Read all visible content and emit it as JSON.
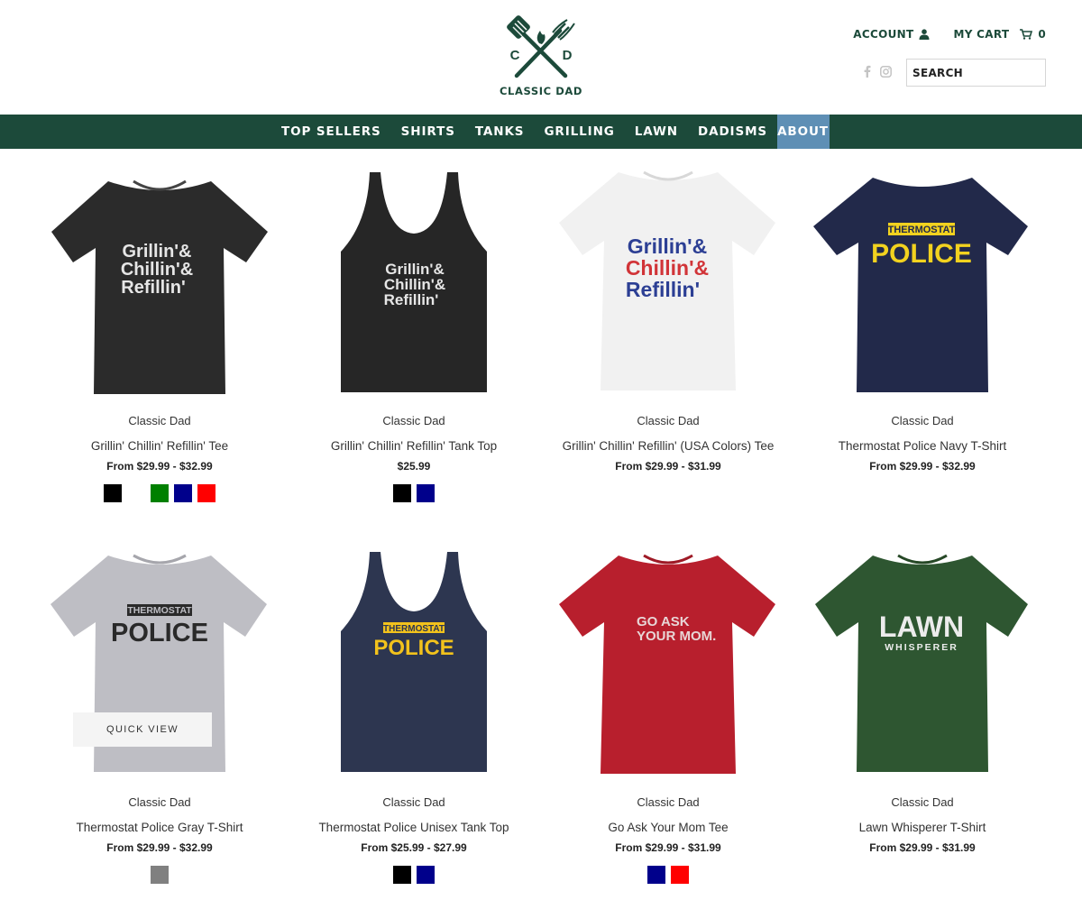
{
  "brand": {
    "logo_letter_left": "C",
    "logo_letter_right": "D",
    "name": "CLASSIC DAD",
    "color": "#1c4a3a"
  },
  "top_links": {
    "account": "ACCOUNT",
    "cart": "MY CART",
    "cart_count": "0"
  },
  "search": {
    "placeholder": "SEARCH"
  },
  "nav": {
    "items": [
      "TOP SELLERS",
      "SHIRTS",
      "TANKS",
      "GRILLING",
      "LAWN",
      "DADISMS",
      "ABOUT"
    ],
    "active": "ABOUT",
    "active_color": "#5e8fb5"
  },
  "products": [
    {
      "vendor": "Classic Dad",
      "title": "Grillin' Chillin' Refillin' Tee",
      "price": "From $29.99 - $32.99",
      "garment": "tee",
      "garment_color": "#2b2b2b",
      "print": [
        "Grillin'&",
        "Chillin'&",
        "Refillin'"
      ],
      "print_colors": [
        "#e6e6e6",
        "#e6e6e6",
        "#e6e6e6"
      ],
      "swatches": [
        "#000000",
        "#ffffff",
        "#008000",
        "#00008b",
        "#ff0000"
      ]
    },
    {
      "vendor": "Classic Dad",
      "title": "Grillin' Chillin' Refillin' Tank Top",
      "price": "$25.99",
      "garment": "tank",
      "garment_color": "#262626",
      "print": [
        "Grillin'&",
        "Chillin'&",
        "Refillin'"
      ],
      "print_colors": [
        "#e6e6e6",
        "#e6e6e6",
        "#e6e6e6"
      ],
      "swatches": [
        "#000000",
        "#00008b"
      ]
    },
    {
      "vendor": "Classic Dad",
      "title": "Grillin' Chillin' Refillin' (USA Colors) Tee",
      "price": "From $29.99 - $31.99",
      "garment": "tee",
      "garment_color": "#f1f1f1",
      "print": [
        "Grillin'&",
        "Chillin'&",
        "Refillin'"
      ],
      "print_colors": [
        "#2c3f94",
        "#d13438",
        "#2c3f94"
      ],
      "swatches": []
    },
    {
      "vendor": "Classic Dad",
      "title": "Thermostat Police Navy T-Shirt",
      "price": "From $29.99 - $32.99",
      "garment": "tee",
      "garment_color": "#22294a",
      "badge": "THERMOSTAT",
      "big": "POLICE",
      "print_color": "#f2d21f",
      "swatches": []
    },
    {
      "vendor": "Classic Dad",
      "title": "Thermostat Police Gray T-Shirt",
      "price": "From $29.99 - $32.99",
      "garment": "tee",
      "garment_color": "#bebec4",
      "badge": "THERMOSTAT",
      "big": "POLICE",
      "print_color": "#2a2a2a",
      "swatches": [
        "#808080"
      ],
      "quick_view": "QUICK VIEW"
    },
    {
      "vendor": "Classic Dad",
      "title": "Thermostat Police Unisex Tank Top",
      "price": "From $25.99 - $27.99",
      "garment": "tank",
      "garment_color": "#2d3650",
      "badge": "THERMOSTAT",
      "big": "POLICE",
      "print_color": "#f2c21c",
      "swatches": [
        "#000000",
        "#00008b"
      ]
    },
    {
      "vendor": "Classic Dad",
      "title": "Go Ask Your Mom Tee",
      "price": "From $29.99 - $31.99",
      "garment": "tee",
      "garment_color": "#b81f2d",
      "print": [
        "GO ASK",
        "YOUR MOM."
      ],
      "print_colors": [
        "#e8d6d6",
        "#e8d6d6"
      ],
      "swatches": [
        "#00008b",
        "#ff0000"
      ]
    },
    {
      "vendor": "Classic Dad",
      "title": "Lawn Whisperer T-Shirt",
      "price": "From $29.99 - $31.99",
      "garment": "tee",
      "garment_color": "#2e5631",
      "big": "LAWN",
      "sub": "WHISPERER",
      "print_color": "#ececec",
      "swatches": []
    }
  ]
}
